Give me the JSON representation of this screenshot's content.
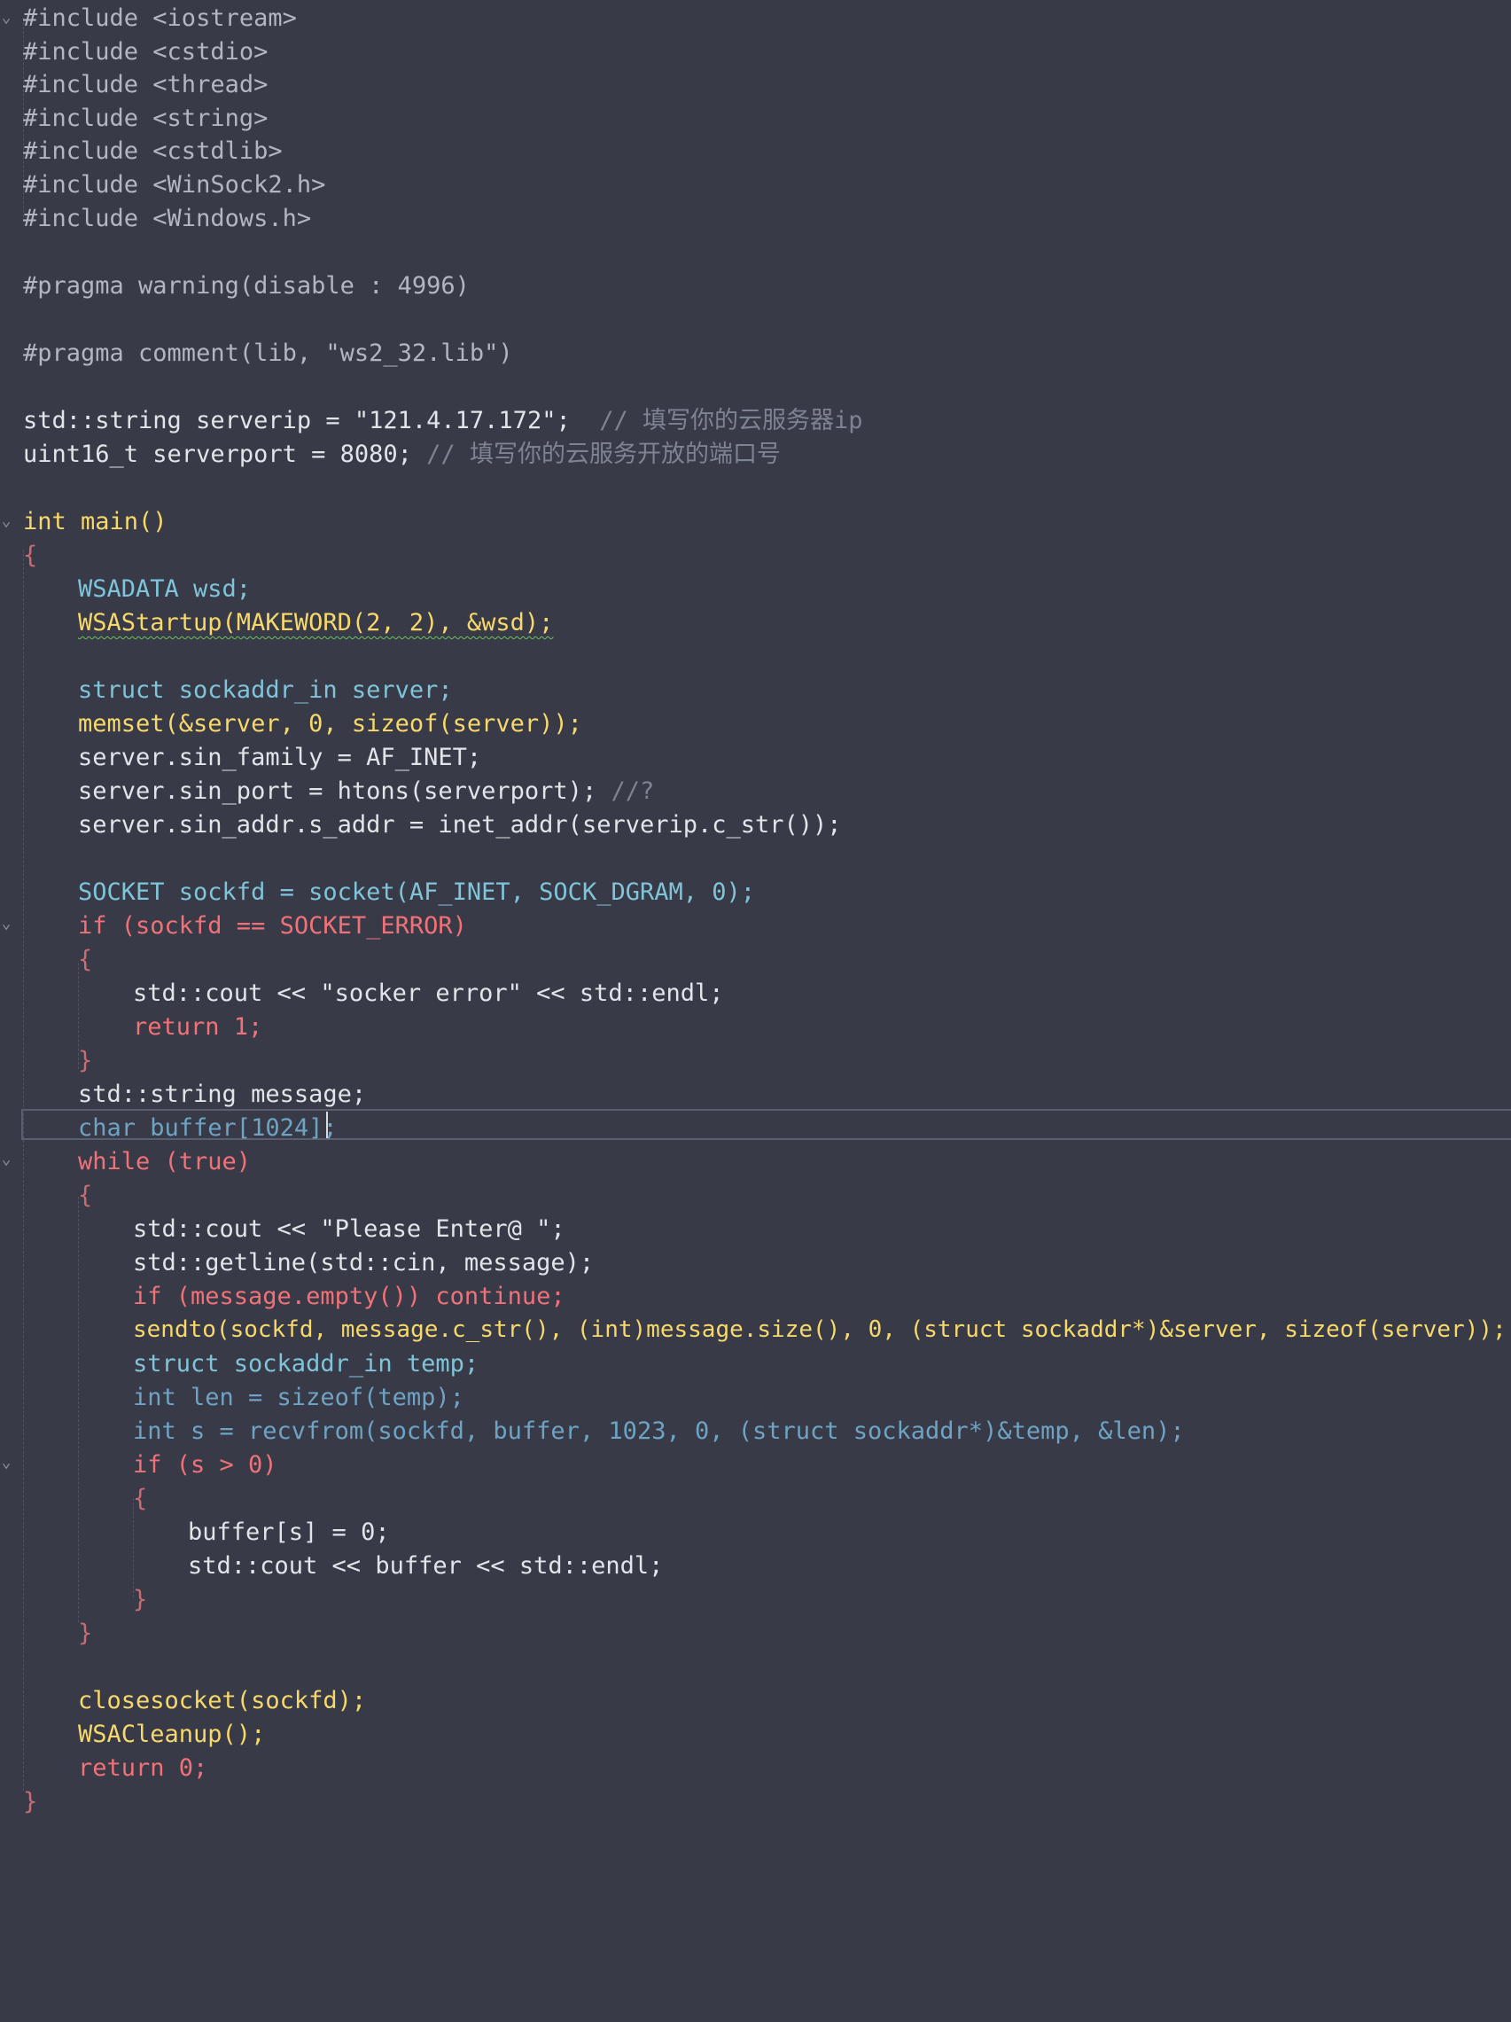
{
  "editor": {
    "language": "C++",
    "colors": {
      "background": "#383b47",
      "string": "#4fc9b0",
      "number": "#f08c75",
      "keyword": "#f07178",
      "type": "#7fc4d8",
      "function": "#f6d86b",
      "comment": "#7e8393"
    },
    "fold_icon": "chevron-down-icon",
    "current_line_number": 34
  },
  "code": {
    "inc1": "#include <iostream>",
    "inc2": "#include <cstdio>",
    "inc3": "#include <thread>",
    "inc4": "#include <string>",
    "inc5": "#include <cstdlib>",
    "inc6": "#include <WinSock2.h>",
    "inc7": "#include <Windows.h>",
    "pragma_warning": "#pragma warning(disable : 4996)",
    "pragma_comment": "#pragma comment(lib, \"ws2_32.lib\")",
    "serverip_decl": "std::string serverip = \"121.4.17.172\";",
    "serverip_comment": "// 填写你的云服务器ip",
    "serverport_decl": "uint16_t serverport = 8080;",
    "serverport_comment": "// 填写你的云服务开放的端口号",
    "main_sig": "int main()",
    "open_main": "{",
    "wsadata": "WSADATA wsd;",
    "wsastartup": "WSAStartup(MAKEWORD(2, 2), &wsd);",
    "sockaddr_decl": "struct sockaddr_in server;",
    "memset": "memset(&server, 0, sizeof(server));",
    "sin_family": "server.sin_family = AF_INET;",
    "sin_port": "server.sin_port = htons(serverport);",
    "sin_port_comment": "//?",
    "sin_addr": "server.sin_addr.s_addr = inet_addr(serverip.c_str());",
    "socket_decl": "SOCKET sockfd = socket(AF_INET, SOCK_DGRAM, 0);",
    "if_error": "if (sockfd == SOCKET_ERROR)",
    "open_if": "{",
    "cout_error": "std::cout << \"socker error\" << std::endl;",
    "return_1": "return 1;",
    "close_if": "}",
    "message_decl": "std::string message;",
    "buffer_decl": "char buffer[1024];",
    "while_true": "while (true)",
    "open_while": "{",
    "cout_prompt": "std::cout << \"Please Enter@ \";",
    "getline": "std::getline(std::cin, message);",
    "if_empty": "if (message.empty()) continue;",
    "sendto": "sendto(sockfd, message.c_str(), (int)message.size(), 0, (struct sockaddr*)&server, sizeof(server));",
    "sockaddr_temp": "struct sockaddr_in temp;",
    "len_decl": "int len = sizeof(temp);",
    "recvfrom": "int s = recvfrom(sockfd, buffer, 1023, 0, (struct sockaddr*)&temp, &len);",
    "if_s": "if (s > 0)",
    "open_if_s": "{",
    "buffer_term": "buffer[s] = 0;",
    "cout_buffer": "std::cout << buffer << std::endl;",
    "close_if_s": "}",
    "close_while": "}",
    "closesocket": "closesocket(sockfd);",
    "wsacleanup": "WSACleanup();",
    "return_0": "return 0;",
    "close_main": "}"
  }
}
